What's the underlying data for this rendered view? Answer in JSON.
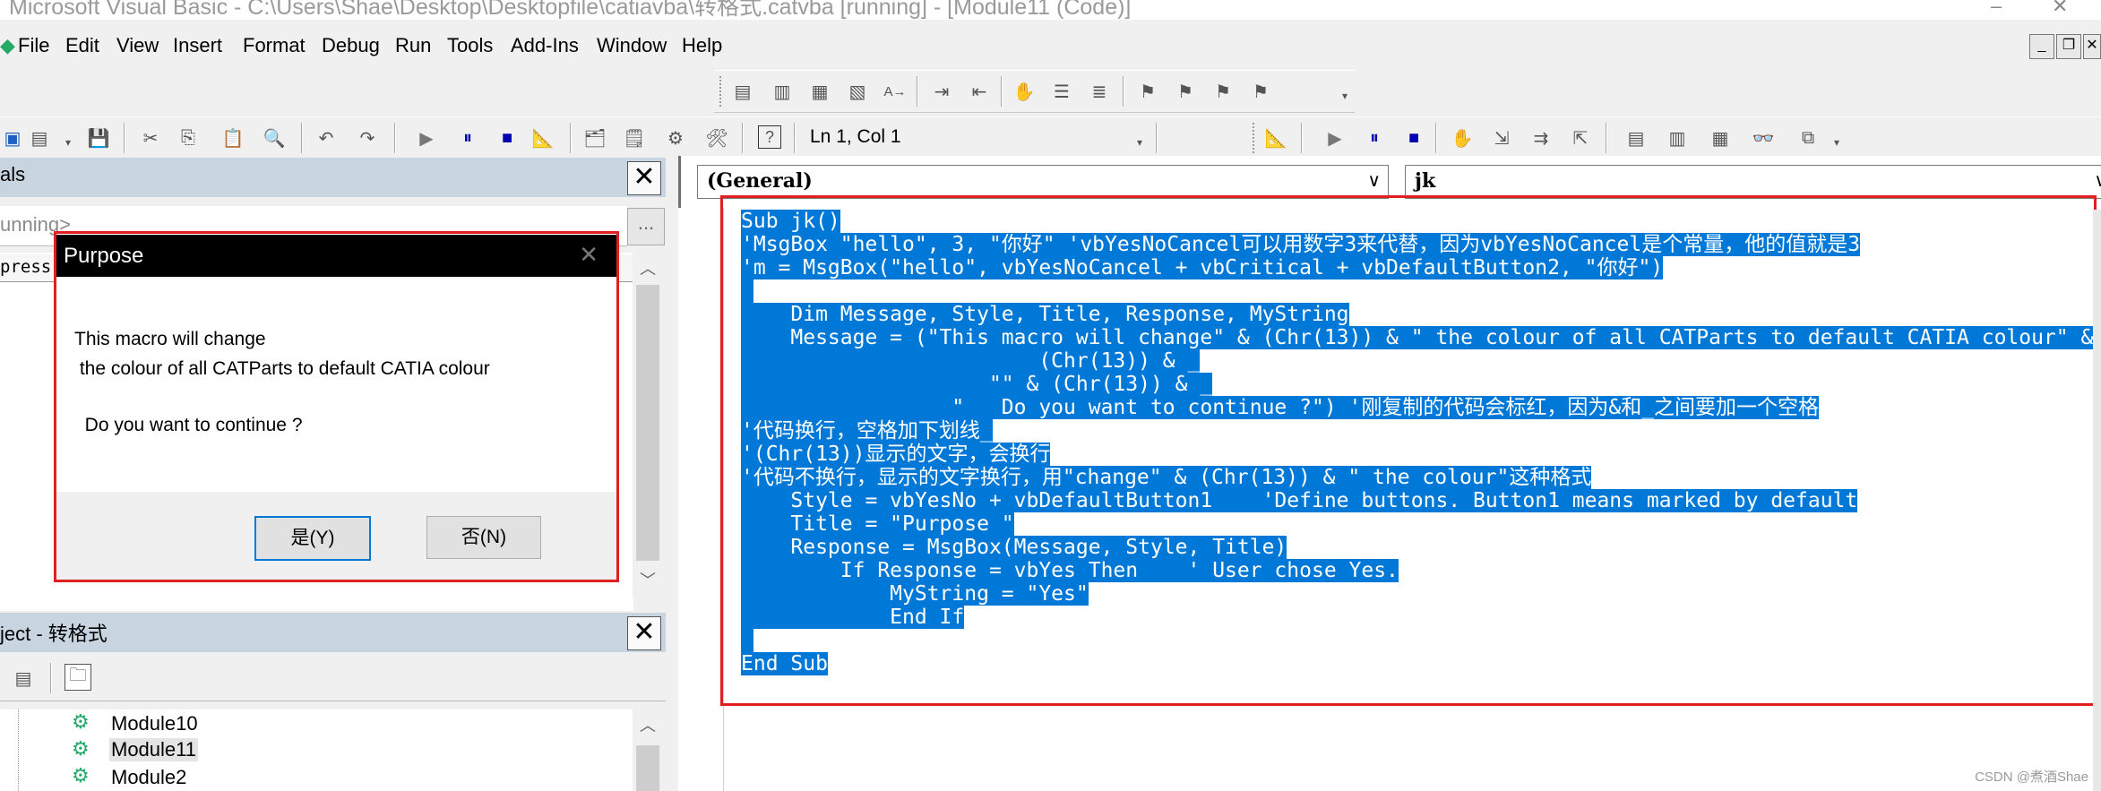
{
  "window": {
    "title": "Microsoft Visual Basic - C:\\Users\\Shae\\Desktop\\Desktopfile\\catiavba\\转格式.catvba [running] - [Module11 (Code)]"
  },
  "menubar": {
    "items": [
      "File",
      "Edit",
      "View",
      "Insert",
      "Format",
      "Debug",
      "Run",
      "Tools",
      "Add-Ins",
      "Window",
      "Help"
    ],
    "mdi_controls": [
      "_",
      "❐",
      "✕"
    ]
  },
  "toolbar": {
    "position": "Ln 1, Col 1"
  },
  "locals_pane": {
    "title": "als",
    "running_text": "unning>",
    "column_header": "press"
  },
  "project_pane": {
    "title": "ject - 转格式",
    "modules": [
      "Module10",
      "Module11",
      "Module2"
    ]
  },
  "code_window": {
    "object_combo": "(General)",
    "procedure_combo": "jk",
    "lines": [
      "Sub jk()",
      "'MsgBox \"hello\", 3, \"你好\" 'vbYesNoCancel可以用数字3来代替，因为vbYesNoCancel是个常量，他的值就是3",
      "'m = MsgBox(\"hello\", vbYesNoCancel + vbCritical + vbDefaultButton2, \"你好\")",
      "",
      "    Dim Message, Style, Title, Response, MyString",
      "    Message = (\"This macro will change\" & (Chr(13)) & \" the colour of all CATParts to default CATIA colour\" & _",
      "                        (Chr(13)) & _",
      "                    \"\" & (Chr(13)) & _",
      "                 \"   Do you want to continue ?\") '刚复制的代码会标红，因为&和_之间要加一个空格",
      "'代码换行，空格加下划线_",
      "'(Chr(13))显示的文字，会换行",
      "'代码不换行，显示的文字换行，用\"change\" & (Chr(13)) & \" the colour\"这种格式",
      "    Style = vbYesNo + vbDefaultButton1    'Define buttons. Button1 means marked by default",
      "    Title = \"Purpose \"",
      "    Response = MsgBox(Message, Style, Title)",
      "        If Response = vbYes Then    ' User chose Yes.",
      "            MyString = \"Yes\"",
      "            End If",
      "",
      "End Sub"
    ]
  },
  "dialog": {
    "title": "Purpose",
    "message_lines": [
      "This macro will change",
      " the colour of all CATParts to default CATIA colour",
      "",
      "  Do you want to continue ?"
    ],
    "yes_label": "是(Y)",
    "no_label": "否(N)"
  },
  "watermark": "CSDN @煮酒Shae",
  "colors": {
    "selection": "#0078d7",
    "annotation_red": "#e02020",
    "pane_header": "#c8d4e0"
  }
}
